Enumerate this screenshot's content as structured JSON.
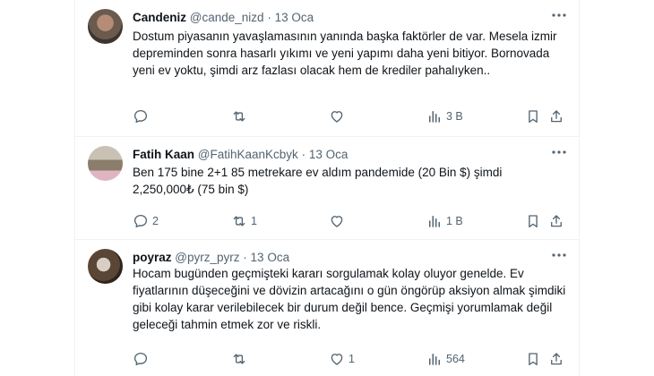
{
  "tweets": [
    {
      "name": "Candeniz",
      "handle": "@cande_nizd",
      "dot": "·",
      "date": "13 Oca",
      "text": "Dostum piyasanın yavaşlamasının yanında başka faktörler de var. Mesela izmir depreminden sonra hasarlı yıkımı ve yeni yapımı daha yeni bitiyor. Bornovada yeni ev yoktu, şimdi arz fazlası olacak hem de krediler pahalıyken..",
      "replies": "",
      "retweets": "",
      "likes": "",
      "views": "3 B"
    },
    {
      "name": "Fatih Kaan",
      "handle": "@FatihKaanKcbyk",
      "dot": "·",
      "date": "13 Oca",
      "text": "Ben 175 bine 2+1 85 metrekare ev aldım pandemide (20 Bin $) şimdi 2,250,000₺ (75 bin $)",
      "replies": "2",
      "retweets": "1",
      "likes": "",
      "views": "1 B"
    },
    {
      "name": "poyraz",
      "handle": "@pyrz_pyrz",
      "dot": "·",
      "date": "13 Oca",
      "text": "Hocam bugünden geçmişteki kararı sorgulamak kolay oluyor genelde. Ev fiyatlarının düşeceğini ve dövizin artacağını o gün öngörüp aksiyon almak şimdiki gibi kolay karar verilebilecek bir durum değil bence. Geçmişi yorumlamak değil geleceği tahmin etmek zor ve riskli.",
      "replies": "",
      "retweets": "",
      "likes": "1",
      "views": "564"
    }
  ],
  "colors": {
    "text": "#0f1419",
    "secondary": "#536471",
    "border": "#eff3f4"
  }
}
